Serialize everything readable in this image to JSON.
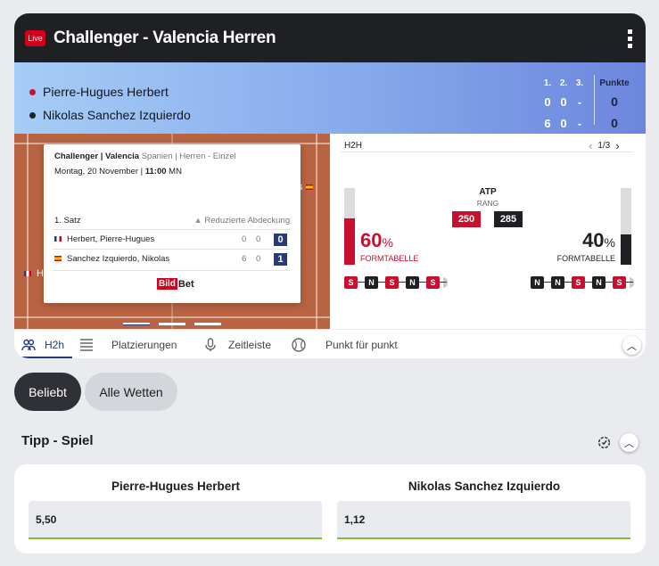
{
  "header": {
    "live_badge": "Live",
    "title": "Challenger - Valencia Herren"
  },
  "scoreboard": {
    "set_headers": [
      "1.",
      "2.",
      "3."
    ],
    "points_header": "Punkte",
    "players": [
      {
        "name": "Pierre-Hugues Herbert",
        "serve_dot_color": "#c8102e",
        "sets": [
          "0",
          "0",
          "-"
        ],
        "points": "0"
      },
      {
        "name": "Nikolas Sanchez Izquierdo",
        "serve_dot_color": "#1f2023",
        "sets": [
          "6",
          "0",
          "-"
        ],
        "points": "0"
      }
    ]
  },
  "match_popup": {
    "tournament": "Challenger | Valencia",
    "details": "Spanien | Herren - Einzel",
    "date": "Montag, 20 November |",
    "time": "11:00",
    "time_suffix": "MN",
    "set_label": "1. Satz",
    "coverage": "Reduzierte Abdeckung",
    "rows": [
      {
        "name": "Herbert, Pierre-Hugues",
        "g1": "0",
        "g2": "0",
        "current": "0"
      },
      {
        "name": "Sanchez Izquierdo, Nikolas",
        "g1": "6",
        "g2": "0",
        "current": "1"
      }
    ],
    "logo_bild": "Bild",
    "logo_bet": "Bet",
    "court_partial_left": "H",
    "court_partial_right": "s"
  },
  "h2h": {
    "label": "H2H",
    "pager": "1/3",
    "rank_title": "ATP",
    "rank_sub": "RANG",
    "rank_left": "250",
    "rank_right": "285",
    "left_pct": "60",
    "right_pct": "40",
    "pct_sign": "%",
    "form_label": "FORMTABELLE",
    "left_form": [
      "S",
      "N",
      "S",
      "N",
      "S"
    ],
    "right_form": [
      "N",
      "N",
      "S",
      "N",
      "S"
    ],
    "left_form_value": 0.6,
    "right_form_value": 0.4,
    "colors": {
      "red": "#c8102e",
      "dark": "#1f2023"
    }
  },
  "tabs": [
    {
      "label": "H2h",
      "icon": "people-icon"
    },
    {
      "label": "Platzierungen",
      "icon": "list-icon"
    },
    {
      "label": "Zeitleiste",
      "icon": "microphone-icon"
    },
    {
      "label": "Punkt für punkt",
      "icon": "tennis-ball-icon"
    }
  ],
  "bet_filters": {
    "popular": "Beliebt",
    "all": "Alle Wetten"
  },
  "tip_section": {
    "title": "Tipp - Spiel",
    "outcomes": [
      {
        "player": "Pierre-Hugues Herbert",
        "odds": "5,50"
      },
      {
        "player": "Nikolas Sanchez Izquierdo",
        "odds": "1,12"
      }
    ]
  }
}
